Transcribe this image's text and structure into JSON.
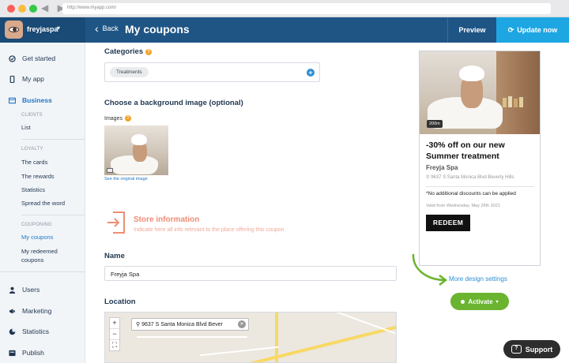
{
  "browser": {
    "url": "http://www.myapp.com/",
    "nav_arrows": "◀ ▶"
  },
  "header": {
    "username": "freyjaspa",
    "back_label": "Back",
    "page_title": "My coupons",
    "preview_label": "Preview",
    "update_label": "Update now"
  },
  "sidebar": {
    "items": [
      {
        "label": "Get started"
      },
      {
        "label": "My app"
      },
      {
        "label": "Business"
      },
      {
        "label": "Users"
      },
      {
        "label": "Marketing"
      },
      {
        "label": "Statistics"
      },
      {
        "label": "Publish"
      }
    ],
    "clients_caption": "CLIENTS",
    "clients_list": "List",
    "loyalty_caption": "LOYALTY",
    "loyalty_items": [
      "The cards",
      "The rewards",
      "Statistics",
      "Spread the word"
    ],
    "couponing_caption": "COUPONING",
    "couponing_items": [
      "My coupons",
      "My redeemed",
      "coupons"
    ]
  },
  "form": {
    "categories_title": "Categories",
    "category_chip": "Treatments",
    "background_title": "Choose a background image (optional)",
    "images_label": "Images",
    "see_original": "See the original image",
    "store_title": "Store information",
    "store_subtitle": "Indicate here all info relevant to the place offering this coupon",
    "name_label": "Name",
    "name_value": "Freyja Spa",
    "location_label": "Location",
    "map_search_value": "9637 S Santa Monica Blvd Bever"
  },
  "preview": {
    "photo_badge": "200m",
    "offer_title": "-30% off on our new Summer treatment",
    "store_name": "Freyja Spa",
    "address": "9637 S Santa Monica Blvd Beverly Hills",
    "note": "*No additional discounts can be applied",
    "valid": "Valid from Wednesday, May 26th 2021",
    "redeem_label": "REDEEM"
  },
  "actions": {
    "more_design": "More design settings",
    "activate_label": "Activate",
    "support_label": "Support"
  },
  "colors": {
    "header": "#1f5585",
    "accent_blue": "#1da6e2",
    "activate_green": "#6ab42f",
    "store_coral": "#ef8d76"
  }
}
